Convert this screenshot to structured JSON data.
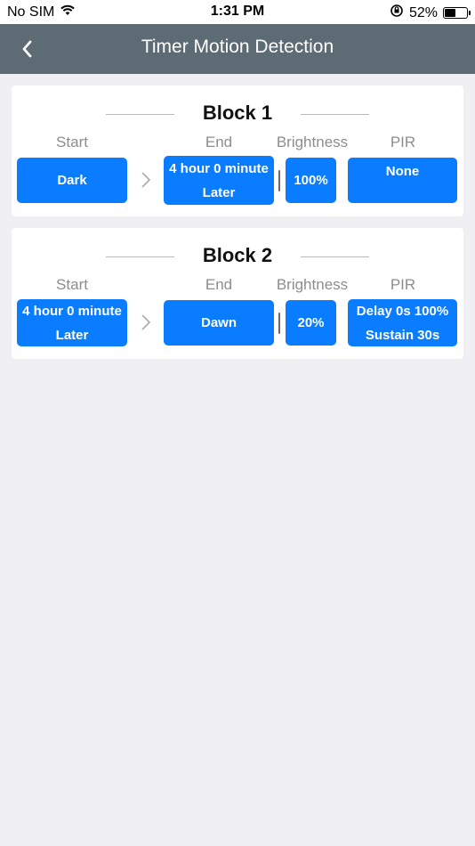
{
  "status_bar": {
    "carrier": "No SIM",
    "time": "1:31 PM",
    "battery_percent": "52%",
    "battery_level": 0.52
  },
  "nav": {
    "title": "Timer Motion Detection"
  },
  "column_labels": {
    "start": "Start",
    "end": "End",
    "brightness": "Brightness",
    "pir": "PIR"
  },
  "blocks": [
    {
      "title": "Block 1",
      "start": [
        "Dark"
      ],
      "end": [
        "4 hour 0 minute",
        "Later"
      ],
      "brightness": "100%",
      "pir": [
        "None"
      ]
    },
    {
      "title": "Block 2",
      "start": [
        "4 hour 0 minute",
        "Later"
      ],
      "end": [
        "Dawn"
      ],
      "brightness": "20%",
      "pir": [
        "Delay 0s 100%",
        "Sustain 30s"
      ]
    }
  ],
  "colors": {
    "nav_bg": "#5d6b74",
    "accent": "#0a7cff",
    "page_bg": "#efeff4"
  }
}
